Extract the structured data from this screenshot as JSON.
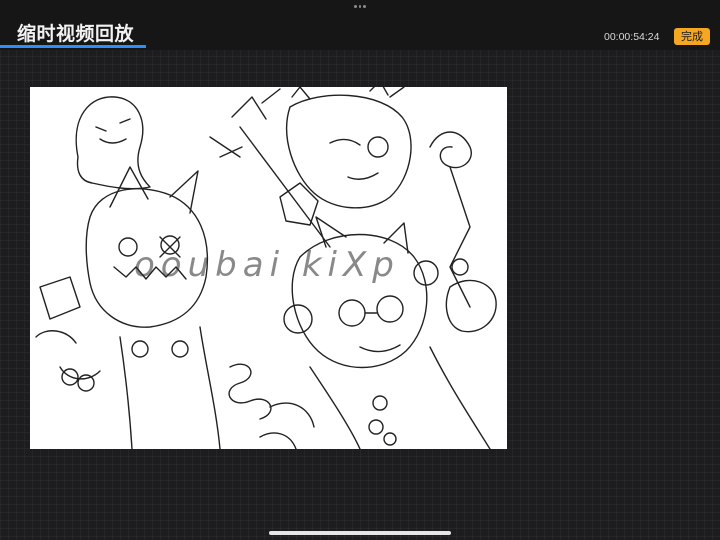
{
  "header": {
    "title": "缩时视频回放",
    "timer": "00:00:54:24",
    "done_label": "完成"
  },
  "artwork": {
    "watermark_text": "ooubai kiXp"
  },
  "colors": {
    "accent_underline": "#2f8ff5",
    "done_button": "#f5a623",
    "background": "#1d1d1f"
  }
}
